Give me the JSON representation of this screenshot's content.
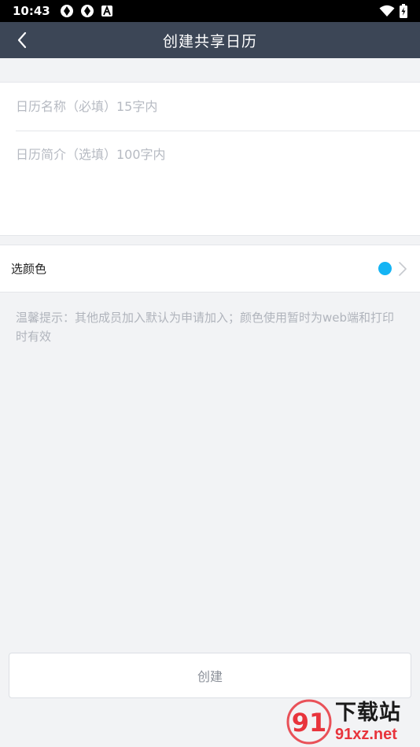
{
  "status_bar": {
    "time": "10:43",
    "left_icons": [
      "sync-icon",
      "sync-icon",
      "text-a-icon"
    ],
    "right_icons": [
      "wifi-icon",
      "battery-charging-icon"
    ]
  },
  "header": {
    "title": "创建共享日历",
    "back_icon": "chevron-left-icon",
    "background": "#3c4656"
  },
  "form": {
    "name_placeholder": "日历名称（必填）15字内",
    "name_value": "",
    "desc_placeholder": "日历简介（选填）100字内",
    "desc_value": ""
  },
  "color_picker": {
    "label": "选颜色",
    "selected_color": "#14b4f4",
    "chevron_icon": "chevron-right-icon"
  },
  "tip": "温馨提示：其他成员加入默认为申请加入；颜色使用暂时为web端和打印时有效",
  "create_button_label": "创建",
  "watermark": {
    "title": "下载站",
    "domain": "91xz.net",
    "logo_text": "91",
    "logo_color": "#e8343c"
  }
}
